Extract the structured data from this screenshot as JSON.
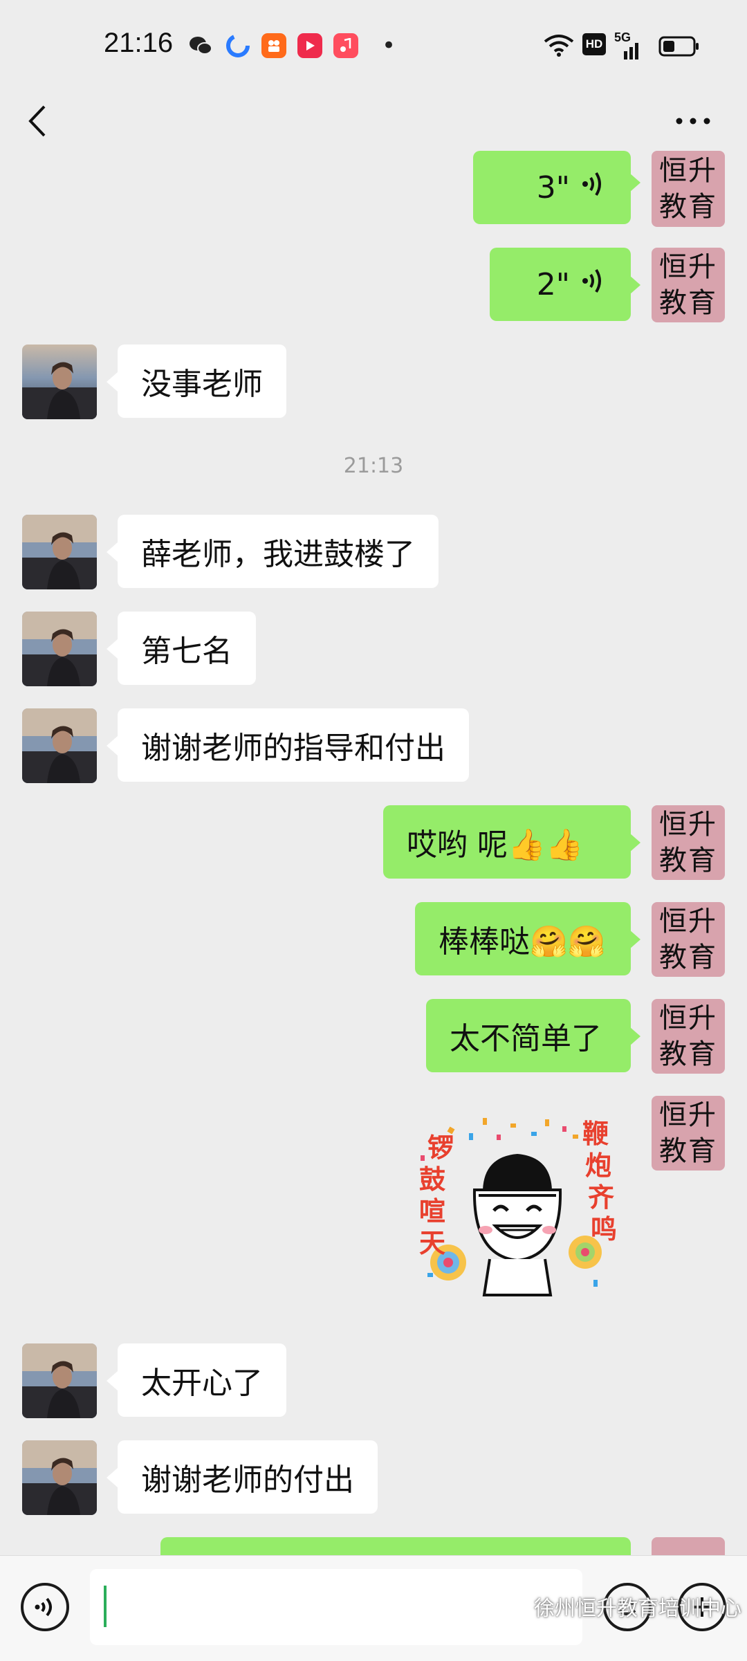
{
  "status_bar": {
    "time": "21:16",
    "dot": "•",
    "hd_badge": "HD",
    "network": "5G"
  },
  "sender_tag": {
    "line1": "恒升",
    "line2": "教育"
  },
  "messages": {
    "m1_duration": "3\"",
    "m2_duration": "2\"",
    "m3": "没事老师",
    "timestamp": "21:13",
    "m4": "薛老师，我进鼓楼了",
    "m5": "第七名",
    "m6": "谢谢老师的指导和付出",
    "m7": "哎哟 呢👍👍",
    "m8": "棒棒哒🤗🤗",
    "m9": "太不简单了",
    "sticker": {
      "left_text": "锣鼓喧天",
      "right_text": "鞭炮齐鸣"
    },
    "m10": "太开心了",
    "m11": "谢谢老师的付出"
  },
  "input": {
    "value": "",
    "placeholder": ""
  },
  "watermark": "徐州恒升教育培训中心",
  "colors": {
    "background": "#ededed",
    "outgoing_bubble": "#95ec69",
    "incoming_bubble": "#ffffff",
    "sender_tag": "#d8a3ad",
    "caret": "#2bae5a"
  }
}
